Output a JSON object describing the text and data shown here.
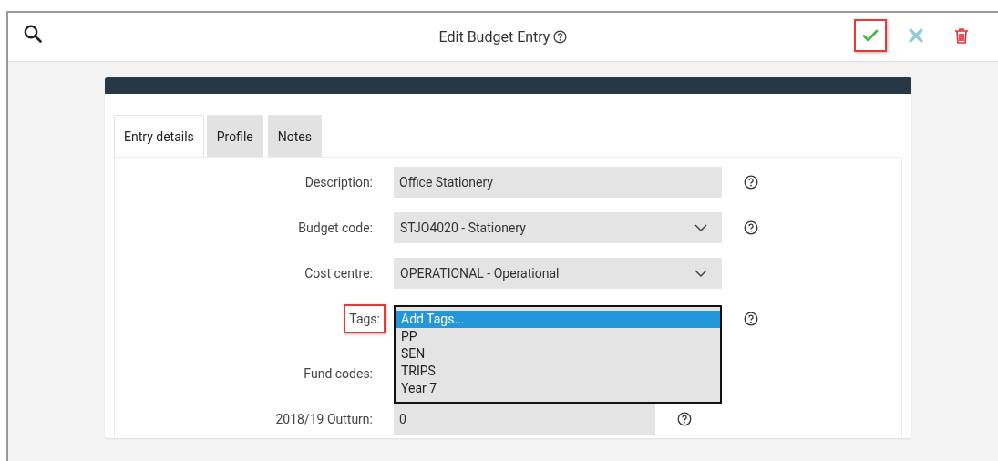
{
  "header": {
    "title": "Edit Budget Entry",
    "actions": [
      {
        "kind": "save",
        "highlighted": true
      },
      {
        "kind": "cancel",
        "highlighted": false
      },
      {
        "kind": "delete",
        "highlighted": false
      }
    ]
  },
  "tabs": [
    {
      "label": "Entry details",
      "selected": true
    },
    {
      "label": "Profile",
      "selected": false
    },
    {
      "label": "Notes",
      "selected": false
    }
  ],
  "fields": [
    {
      "kind": "text",
      "label": "Description:",
      "value": "Office Stationery",
      "help": true,
      "highlighted": false
    },
    {
      "kind": "select",
      "label": "Budget code:",
      "value": "STJO4020 - Stationery",
      "help": true,
      "highlighted": false
    },
    {
      "kind": "select",
      "label": "Cost centre:",
      "value": "OPERATIONAL - Operational",
      "help": false,
      "highlighted": false
    },
    {
      "kind": "listbox",
      "label": "Tags:",
      "help": true,
      "highlighted": true,
      "options": [
        {
          "label": "Add Tags...",
          "selected": true
        },
        {
          "label": "PP",
          "selected": false
        },
        {
          "label": "SEN",
          "selected": false
        },
        {
          "label": "TRIPS",
          "selected": false
        },
        {
          "label": "Year 7",
          "selected": false
        }
      ]
    },
    {
      "kind": "hidden",
      "label": "Fund codes:",
      "help": false,
      "highlighted": false
    },
    {
      "kind": "short",
      "label": "2018/19 Outturn:",
      "value": "0",
      "help": true,
      "highlighted": false
    }
  ]
}
